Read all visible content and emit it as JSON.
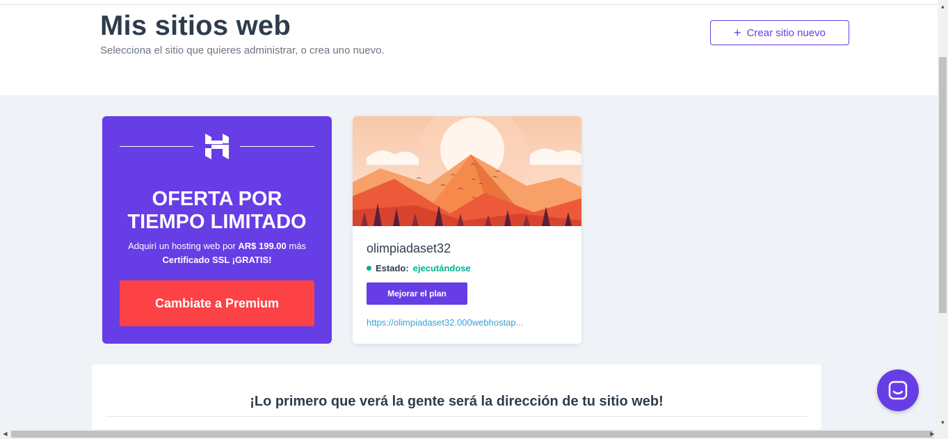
{
  "header": {
    "title": "Mis sitios web",
    "subtitle": "Selecciona el sitio que quieres administrar, o crea uno nuevo.",
    "new_site_button": "Crear sitio nuevo",
    "new_site_icon": "plus-icon"
  },
  "promo": {
    "logo": "hostinger-logo",
    "title_line1": "OFERTA POR",
    "title_line2": "TIEMPO LIMITADO",
    "desc_prefix": "Adquirí un hosting web por ",
    "price": "AR$ 199.00",
    "desc_suffix": " más",
    "desc_line2": "Certificado SSL ¡GRATIS!",
    "button": "Cambiate a Premium"
  },
  "site": {
    "name": "olimpiadaset32",
    "status_label": "Estado:",
    "status_value": "ejecutándose",
    "upgrade_button": "Mejorar el plan",
    "url": "https://olimpiadaset32.000webhostap..."
  },
  "bottom": {
    "heading": "¡Lo primero que verá la gente será la dirección de tu sitio web!"
  },
  "chat": {
    "icon": "chat-icon"
  },
  "colors": {
    "brand": "#673de6",
    "danger": "#fc4245",
    "success": "#00b090",
    "link": "#3ba0d5"
  }
}
